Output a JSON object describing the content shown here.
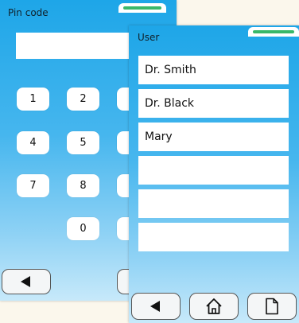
{
  "pin_panel": {
    "title": "Pin code",
    "display_value": "",
    "keys": [
      "1",
      "2",
      "",
      "4",
      "5",
      "",
      "7",
      "8",
      "",
      "0",
      ""
    ]
  },
  "user_panel": {
    "title": "User",
    "users": [
      "Dr. Smith",
      "Dr. Black",
      "Mary",
      "",
      "",
      ""
    ]
  },
  "colors": {
    "panel_top": "#1ea6e8",
    "panel_bottom": "#c7e9fa",
    "handle_stripe": "#39b86a",
    "background": "#fbf7ec"
  },
  "icons": {
    "back": "back-arrow-icon",
    "home": "home-icon",
    "document": "document-icon"
  }
}
